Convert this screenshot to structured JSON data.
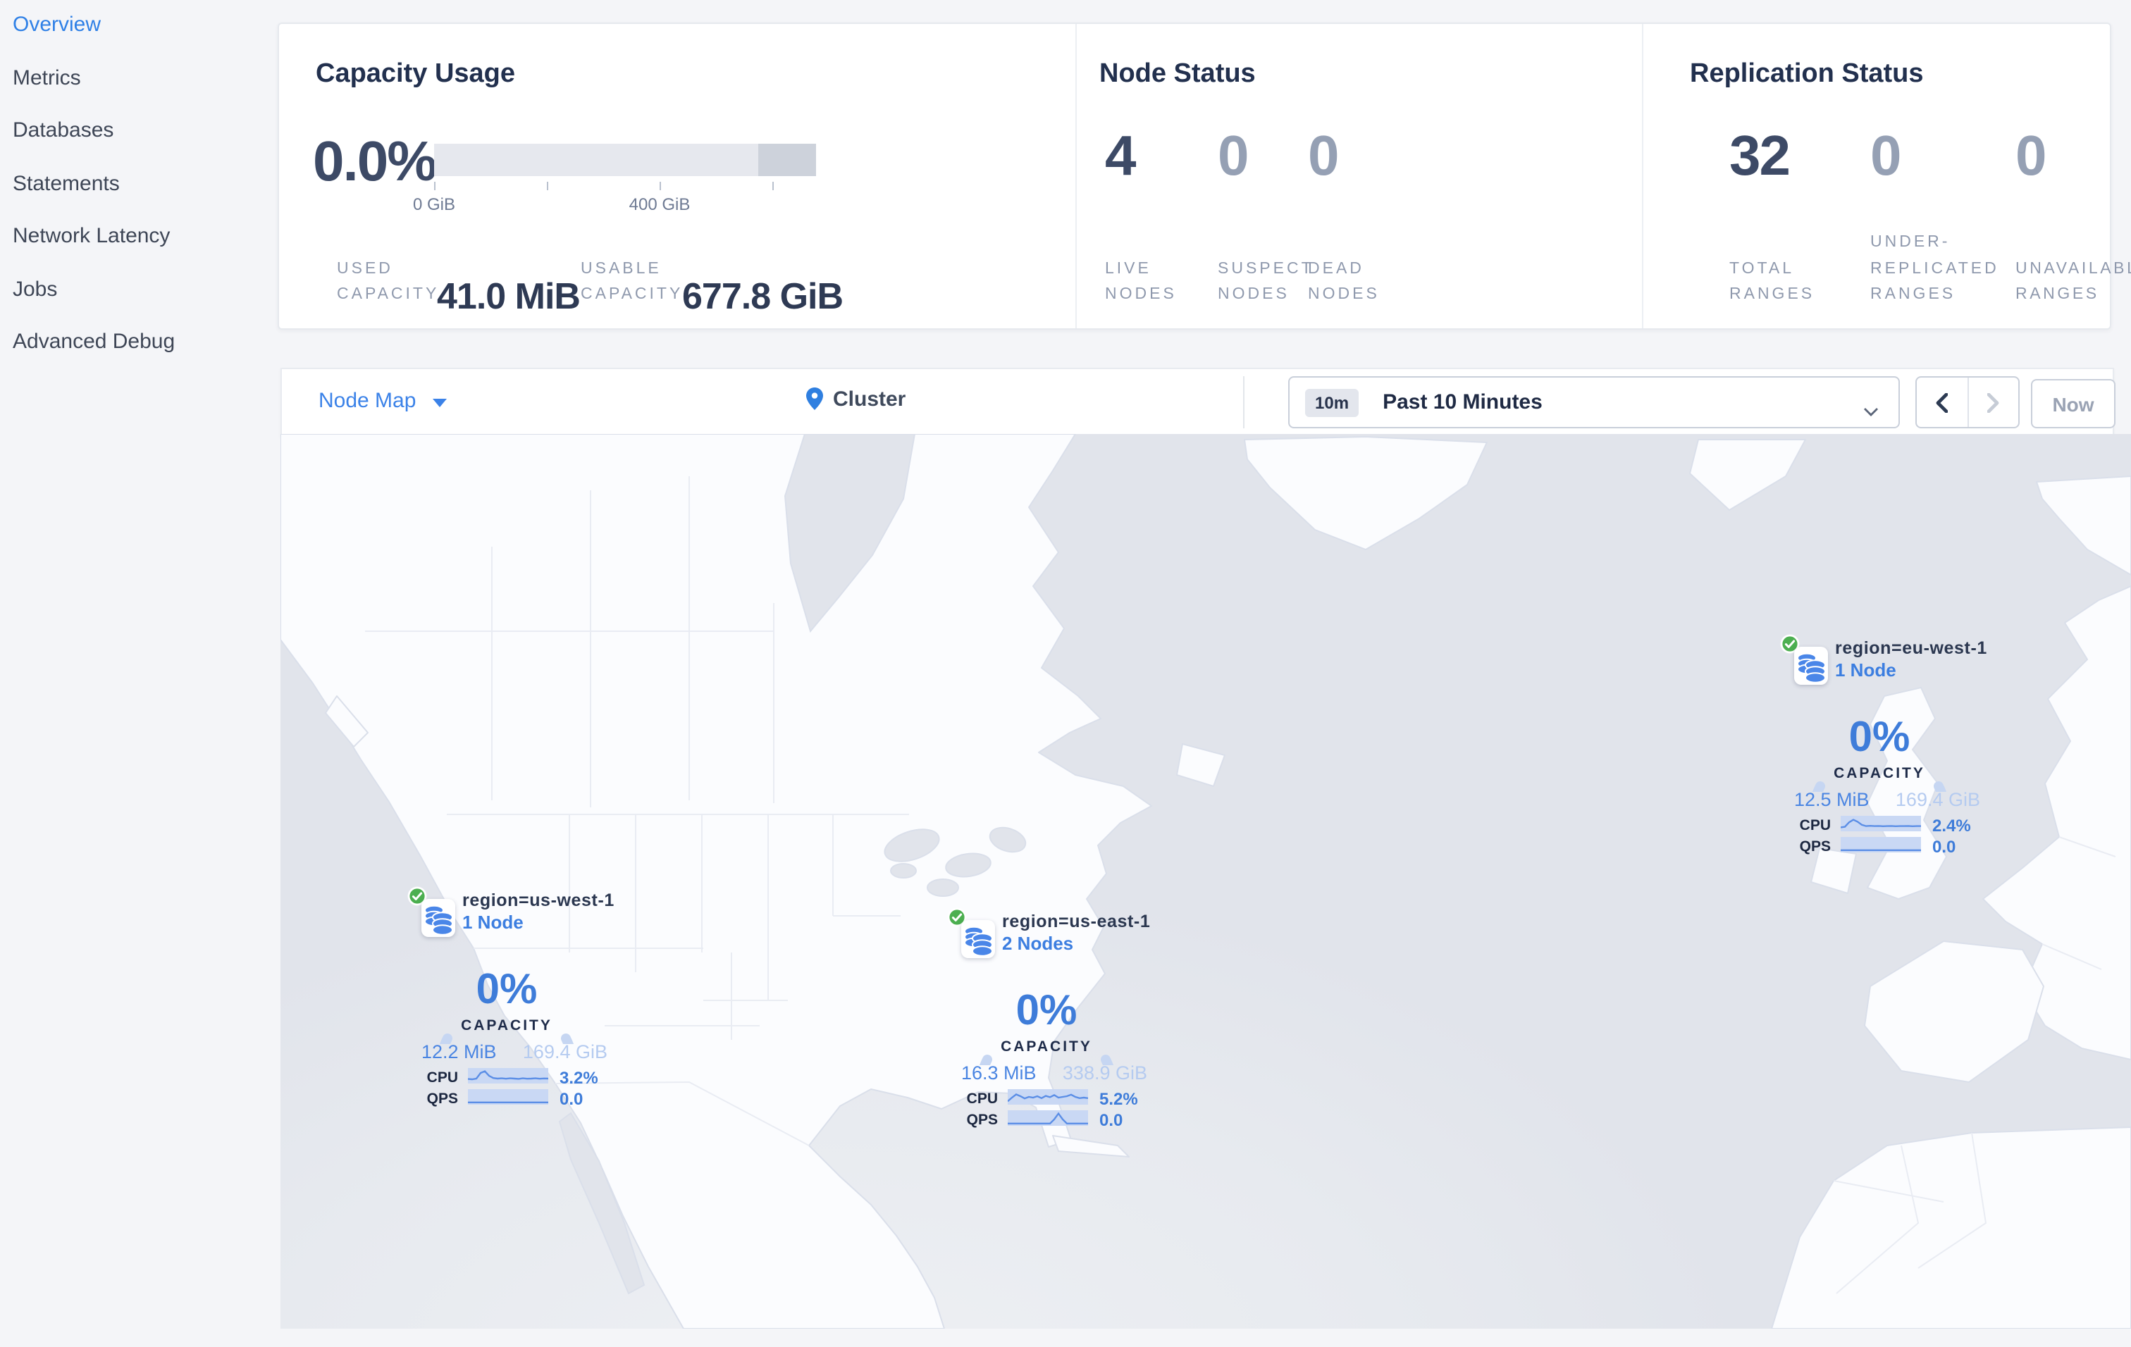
{
  "sidebar": {
    "items": [
      {
        "label": "Overview",
        "active": true
      },
      {
        "label": "Metrics",
        "active": false
      },
      {
        "label": "Databases",
        "active": false
      },
      {
        "label": "Statements",
        "active": false
      },
      {
        "label": "Network Latency",
        "active": false
      },
      {
        "label": "Jobs",
        "active": false
      },
      {
        "label": "Advanced Debug",
        "active": false
      }
    ]
  },
  "summary": {
    "capacity": {
      "title": "Capacity Usage",
      "percent": "0.0%",
      "tick_labels": [
        "0 GiB",
        "400 GiB"
      ],
      "used_label": "USED CAPACITY",
      "used_value": "41.0 MiB",
      "usable_label": "USABLE CAPACITY",
      "usable_value": "677.8 GiB"
    },
    "nodes": {
      "title": "Node Status",
      "stats": [
        {
          "value": "4",
          "label": "LIVE NODES",
          "dim": false
        },
        {
          "value": "0",
          "label": "SUSPECT NODES",
          "dim": true
        },
        {
          "value": "0",
          "label": "DEAD NODES",
          "dim": true
        }
      ]
    },
    "replication": {
      "title": "Replication Status",
      "stats": [
        {
          "value": "32",
          "label": "TOTAL RANGES",
          "dim": false
        },
        {
          "value": "0",
          "label": "UNDER-REPLICATED RANGES",
          "dim": true
        },
        {
          "value": "0",
          "label": "UNAVAILABLE RANGES",
          "dim": true
        }
      ]
    }
  },
  "toolbar": {
    "view_selector": "Node Map",
    "breadcrumb": "Cluster",
    "range_badge": "10m",
    "range_label": "Past 10 Minutes",
    "now_label": "Now"
  },
  "map": {
    "regions": [
      {
        "name": "region=us-west-1",
        "nodes_label": "1 Node",
        "capacity_pct": "0%",
        "capacity_label": "CAPACITY",
        "used": "12.2 MiB",
        "total": "169.4 GiB",
        "cpu_label": "CPU",
        "cpu_value": "3.2%",
        "qps_label": "QPS",
        "qps_value": "0.0",
        "cpu_spark": [
          0.75,
          0.78,
          0.72,
          0.28,
          0.15,
          0.5,
          0.68,
          0.72,
          0.7,
          0.73,
          0.7,
          0.72,
          0.74,
          0.7,
          0.73,
          0.72,
          0.7,
          0.73,
          0.71,
          0.72
        ],
        "qps_spark": [
          0.93,
          0.93,
          0.93,
          0.93,
          0.93,
          0.93,
          0.93,
          0.93,
          0.93,
          0.93,
          0.93,
          0.93,
          0.93,
          0.93,
          0.93,
          0.93,
          0.93,
          0.93,
          0.93,
          0.93
        ]
      },
      {
        "name": "region=us-east-1",
        "nodes_label": "2 Nodes",
        "capacity_pct": "0%",
        "capacity_label": "CAPACITY",
        "used": "16.3 MiB",
        "total": "338.9 GiB",
        "cpu_label": "CPU",
        "cpu_value": "5.2%",
        "qps_label": "QPS",
        "qps_value": "0.0",
        "cpu_spark": [
          0.85,
          0.55,
          0.3,
          0.45,
          0.62,
          0.5,
          0.56,
          0.45,
          0.6,
          0.42,
          0.52,
          0.35,
          0.55,
          0.5,
          0.45,
          0.32,
          0.5,
          0.6,
          0.55,
          0.6
        ],
        "qps_spark": [
          0.93,
          0.93,
          0.93,
          0.93,
          0.93,
          0.93,
          0.93,
          0.93,
          0.93,
          0.93,
          0.93,
          0.6,
          0.15,
          0.6,
          0.93,
          0.93,
          0.93,
          0.93,
          0.93,
          0.93
        ]
      },
      {
        "name": "region=eu-west-1",
        "nodes_label": "1 Node",
        "capacity_pct": "0%",
        "capacity_label": "CAPACITY",
        "used": "12.5 MiB",
        "total": "169.4 GiB",
        "cpu_label": "CPU",
        "cpu_value": "2.4%",
        "qps_label": "QPS",
        "qps_value": "0.0",
        "cpu_spark": [
          0.8,
          0.75,
          0.4,
          0.2,
          0.35,
          0.6,
          0.7,
          0.68,
          0.7,
          0.69,
          0.71,
          0.7,
          0.69,
          0.71,
          0.7,
          0.7,
          0.69,
          0.71,
          0.7,
          0.7
        ],
        "qps_spark": [
          0.93,
          0.93,
          0.93,
          0.93,
          0.93,
          0.93,
          0.93,
          0.93,
          0.93,
          0.93,
          0.93,
          0.93,
          0.93,
          0.93,
          0.93,
          0.93,
          0.93,
          0.93,
          0.93,
          0.93
        ]
      }
    ]
  },
  "colors": {
    "accent_blue": "#3b82e8",
    "link_blue": "#3c7ee0",
    "pct_blue": "#3e7cd9",
    "arc_blue": "#c6d6f2",
    "total_blue": "#b5cbf0",
    "spark_band": "#c9d8f4",
    "spark_line": "#5b8ee6",
    "status_green": "#4caf50",
    "navy_text": "#22304e",
    "number_slate": "#3d4a66",
    "dim_number": "#95a0b4",
    "muted_label": "#8f99ad",
    "ocean": "#e1e4eb",
    "land": "#fbfcfe",
    "page_bg": "#f4f5f8"
  }
}
